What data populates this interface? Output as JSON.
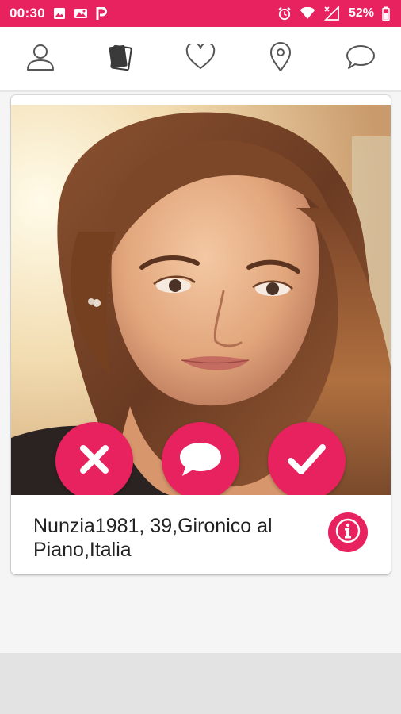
{
  "status_bar": {
    "time": "00:30",
    "battery_percent": "52%",
    "icons_left": [
      "image-icon",
      "photo-icon",
      "parking-icon"
    ],
    "icons_right": [
      "alarm-icon",
      "wifi-icon",
      "signal-icon",
      "battery-icon"
    ]
  },
  "nav": {
    "items": [
      {
        "icon": "profile-icon",
        "active": false
      },
      {
        "icon": "cards-icon",
        "active": true
      },
      {
        "icon": "heart-icon",
        "active": false
      },
      {
        "icon": "location-pin-icon",
        "active": false
      },
      {
        "icon": "chat-bubble-icon",
        "active": false
      }
    ]
  },
  "card": {
    "profile_text": "Nunzia1981, 39,Gironico al Piano,Italia",
    "actions": [
      "dislike-button",
      "message-button",
      "like-button"
    ]
  },
  "colors": {
    "accent": "#e8215f",
    "nav_icon": "#555555",
    "nav_icon_active": "#3a3a3a",
    "background": "#f5f5f5"
  }
}
